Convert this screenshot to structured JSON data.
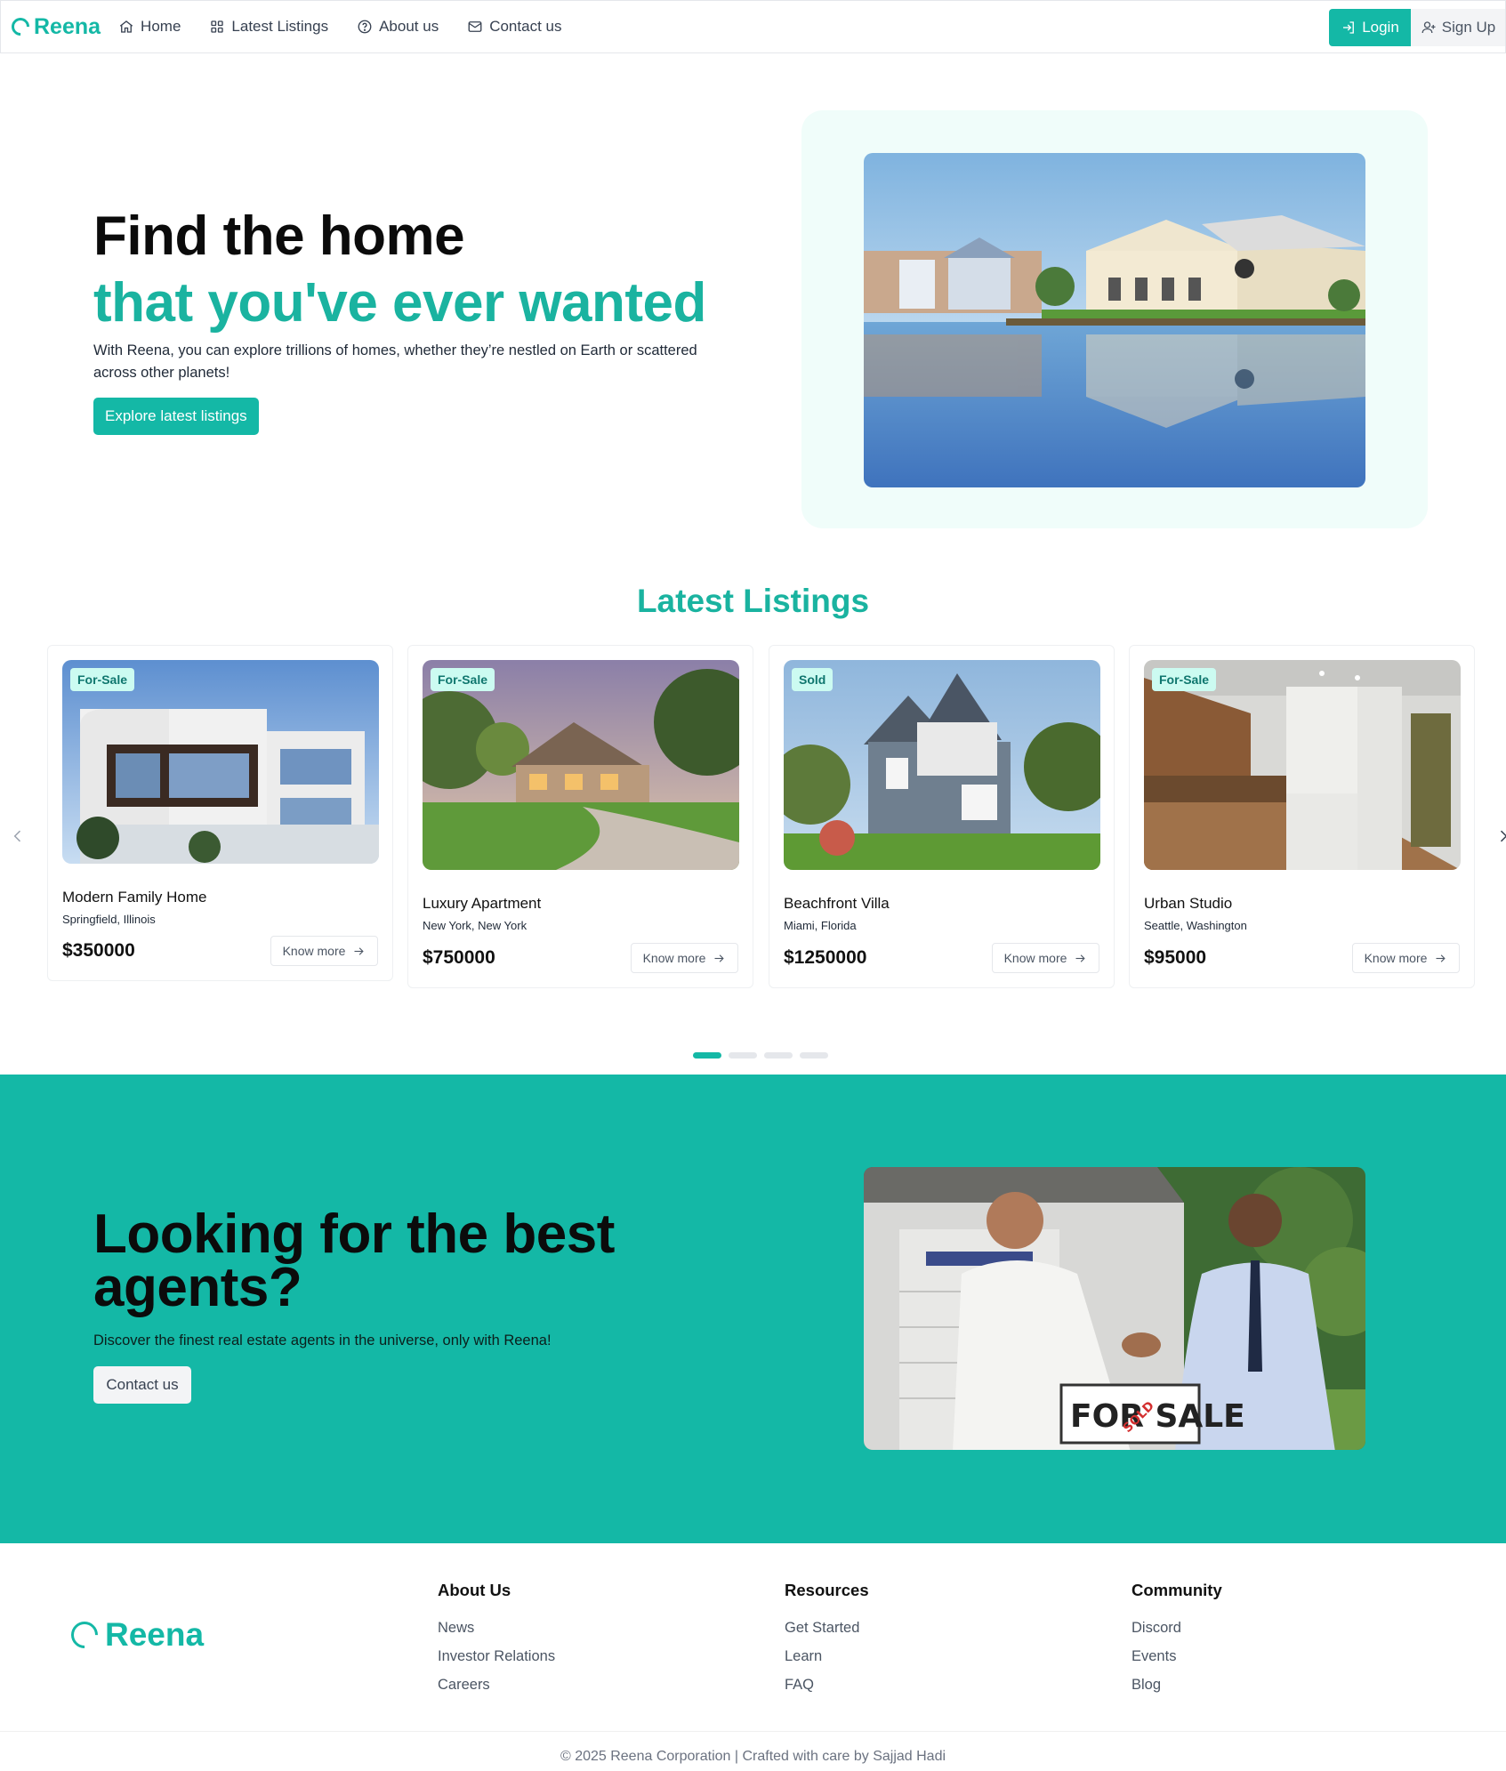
{
  "nav": {
    "brand": "Reena",
    "links": [
      {
        "label": "Home"
      },
      {
        "label": "Latest Listings"
      },
      {
        "label": "About us"
      },
      {
        "label": "Contact us"
      }
    ],
    "login": "Login",
    "signup": "Sign Up"
  },
  "hero": {
    "line1": "Find the home",
    "line2": "that you've ever wanted",
    "description": "With Reena, you can explore trillions of homes, whether they’re nestled on Earth or scattered across other planets!",
    "cta": "Explore latest listings"
  },
  "listings": {
    "title": "Latest Listings",
    "know_more": "Know more",
    "items": [
      {
        "status": "For-Sale",
        "title": "Modern Family Home",
        "location": "Springfield, Illinois",
        "price": "$350000"
      },
      {
        "status": "For-Sale",
        "title": "Luxury Apartment",
        "location": "New York, New York",
        "price": "$750000"
      },
      {
        "status": "Sold",
        "title": "Beachfront Villa",
        "location": "Miami, Florida",
        "price": "$1250000"
      },
      {
        "status": "For-Sale",
        "title": "Urban Studio",
        "location": "Seattle, Washington",
        "price": "$95000"
      }
    ],
    "pages": 4,
    "active_page": 1
  },
  "agents": {
    "title": "Looking for the best agents?",
    "description": "Discover the finest real estate agents in the universe, only with Reena!",
    "cta": "Contact us",
    "sign_text": "FOR SALE",
    "sign_overlay": "SOLD"
  },
  "footer": {
    "brand": "Reena",
    "columns": [
      {
        "title": "About Us",
        "links": [
          "News",
          "Investor Relations",
          "Careers"
        ]
      },
      {
        "title": "Resources",
        "links": [
          "Get Started",
          "Learn",
          "FAQ"
        ]
      },
      {
        "title": "Community",
        "links": [
          "Discord",
          "Events",
          "Blog"
        ]
      }
    ],
    "copyright": "© 2025 Reena Corporation | Crafted with care by Sajjad Hadi"
  },
  "colors": {
    "accent": "#14b8a6",
    "accent_text": "#1ab3a0",
    "badge_bg": "#ccfbf1",
    "hero_panel": "#f0fdfa"
  }
}
